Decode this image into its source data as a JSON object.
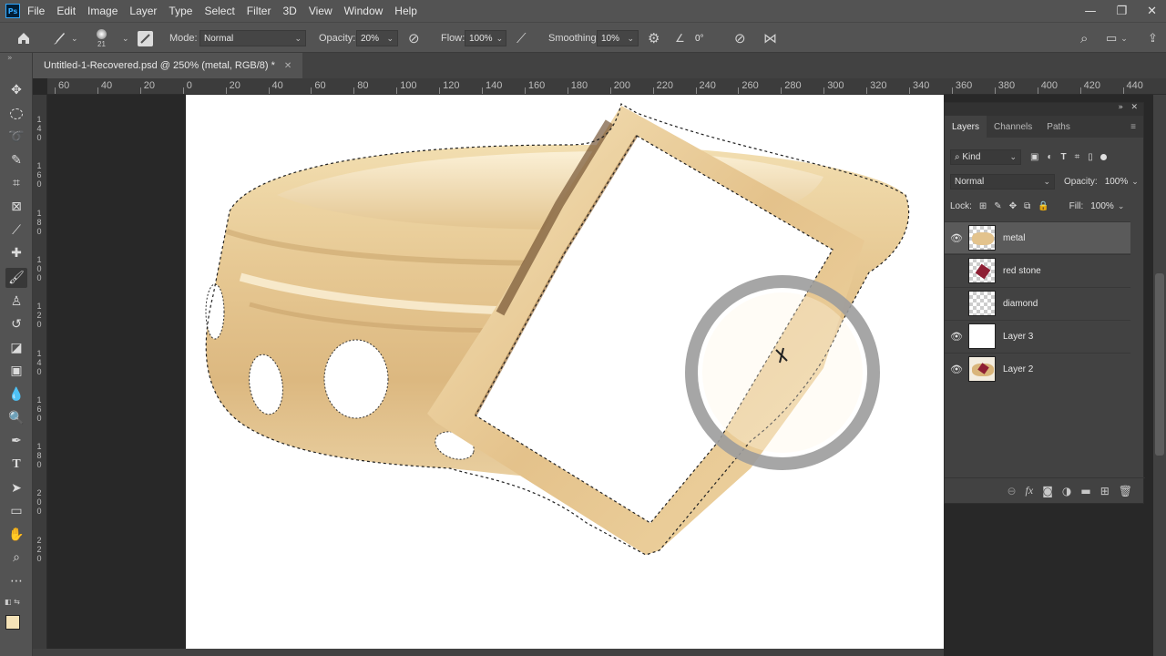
{
  "app": {
    "logo": "Ps"
  },
  "menu": [
    "File",
    "Edit",
    "Image",
    "Layer",
    "Type",
    "Select",
    "Filter",
    "3D",
    "View",
    "Window",
    "Help"
  ],
  "window_controls": {
    "minimize": "—",
    "restore": "❐",
    "close": "✕"
  },
  "options": {
    "brush_size": "21",
    "mode_label": "Mode:",
    "mode_value": "Normal",
    "opacity_label": "Opacity:",
    "opacity_value": "20%",
    "flow_label": "Flow:",
    "flow_value": "100%",
    "smoothing_label": "Smoothing:",
    "smoothing_value": "10%",
    "angle_value": "0°"
  },
  "document": {
    "tab_title": "Untitled-1-Recovered.psd @ 250% (metal, RGB/8) *",
    "close": "✕"
  },
  "ruler_h": [
    "60",
    "40",
    "20",
    "0",
    "20",
    "40",
    "60",
    "80",
    "100",
    "120",
    "140",
    "160",
    "180",
    "200",
    "220",
    "240",
    "260",
    "280",
    "300",
    "320",
    "340",
    "360",
    "380",
    "400",
    "420",
    "440"
  ],
  "ruler_v": [
    "1",
    "4",
    "0",
    "1",
    "6",
    "0",
    "1",
    "8",
    "0",
    "1",
    "0",
    "0",
    "1",
    "2",
    "0",
    "1",
    "4",
    "0",
    "1",
    "6",
    "0",
    "1",
    "8",
    "0",
    "2",
    "0",
    "0",
    "2",
    "2",
    "0"
  ],
  "layers_panel": {
    "tabs": [
      "Layers",
      "Channels",
      "Paths"
    ],
    "kind_label": "Kind",
    "blend_mode": "Normal",
    "opacity_label": "Opacity:",
    "opacity_value": "100%",
    "lock_label": "Lock:",
    "fill_label": "Fill:",
    "fill_value": "100%",
    "layers": [
      {
        "name": "metal",
        "visible": true,
        "selected": true
      },
      {
        "name": "red stone",
        "visible": false,
        "selected": false
      },
      {
        "name": "diamond",
        "visible": false,
        "selected": false
      },
      {
        "name": "Layer 3",
        "visible": true,
        "selected": false
      },
      {
        "name": "Layer 2",
        "visible": true,
        "selected": false
      }
    ]
  },
  "colors": {
    "foreground": "#f5e3b8",
    "background": "#ffffff",
    "gold": "#e9c98f",
    "ui_dark": "#282828",
    "ui_mid": "#535353"
  }
}
